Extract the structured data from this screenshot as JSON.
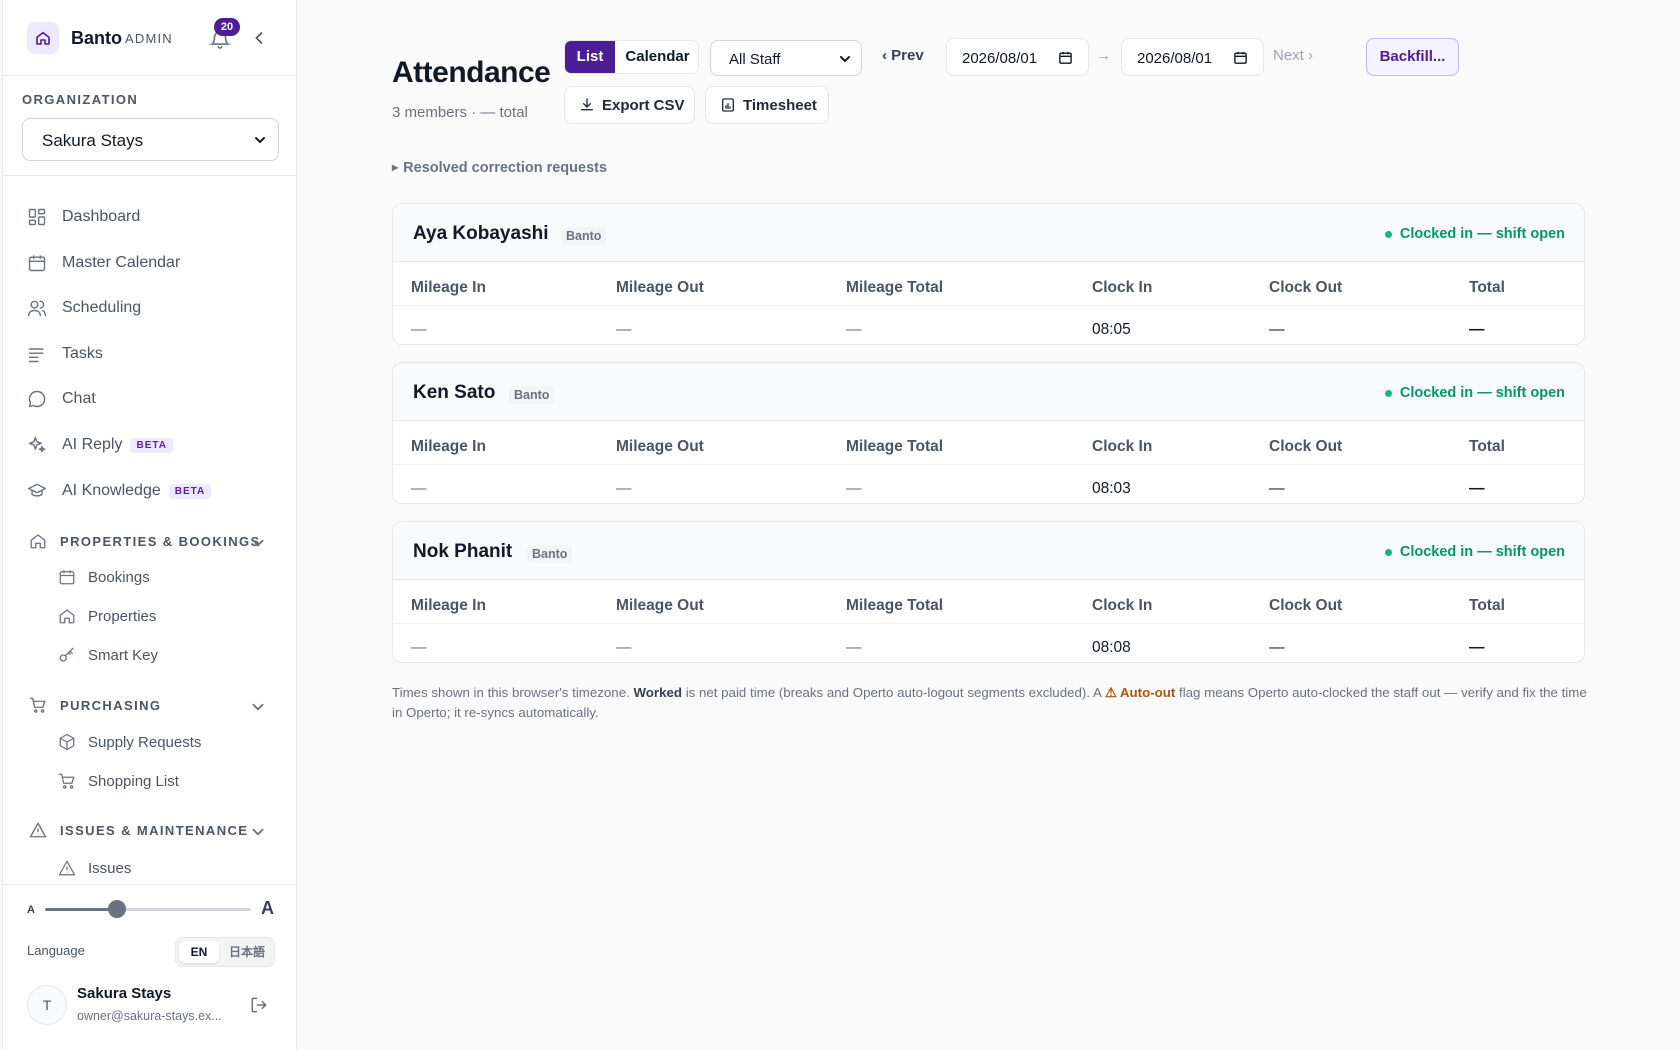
{
  "brand": {
    "name": "Banto",
    "role": "ADMIN",
    "notifications": "20",
    "accent": "#4c1d95"
  },
  "org": {
    "label": "ORGANIZATION",
    "selected": "Sakura Stays"
  },
  "nav": {
    "items": [
      {
        "label": "Dashboard",
        "icon": "dashboard-icon"
      },
      {
        "label": "Master Calendar",
        "icon": "calendar-icon"
      },
      {
        "label": "Scheduling",
        "icon": "users-icon"
      },
      {
        "label": "Tasks",
        "icon": "list-icon"
      },
      {
        "label": "Chat",
        "icon": "chat-icon"
      },
      {
        "label": "AI Reply",
        "icon": "sparkle-icon",
        "badge": "BETA"
      },
      {
        "label": "AI Knowledge",
        "icon": "graduation-cap-icon",
        "badge": "BETA"
      }
    ],
    "sections": [
      {
        "label": "PROPERTIES & BOOKINGS",
        "icon": "home-icon",
        "items": [
          {
            "label": "Bookings",
            "icon": "calendar-icon"
          },
          {
            "label": "Properties",
            "icon": "home-icon"
          },
          {
            "label": "Smart Key",
            "icon": "key-icon"
          }
        ]
      },
      {
        "label": "PURCHASING",
        "icon": "cart-icon",
        "items": [
          {
            "label": "Supply Requests",
            "icon": "box-icon"
          },
          {
            "label": "Shopping List",
            "icon": "cart-icon"
          }
        ]
      },
      {
        "label": "ISSUES & MAINTENANCE",
        "icon": "warning-icon",
        "items": [
          {
            "label": "Issues",
            "icon": "warning-icon"
          }
        ]
      }
    ]
  },
  "footer": {
    "font_small": "A",
    "font_large": "A",
    "font_scale": 0.35,
    "language_label": "Language",
    "lang_en": "EN",
    "lang_ja": "日本語",
    "avatar_initial": "T",
    "user_name": "Sakura Stays",
    "user_email": "owner@sakura-stays.ex..."
  },
  "page": {
    "title": "Attendance",
    "subtitle": "3 members · — total",
    "view_list": "List",
    "view_calendar": "Calendar",
    "staff_filter": "All Staff",
    "prev": "‹ Prev",
    "next": "Next ›",
    "date_from": "2026/08/01",
    "date_to": "2026/08/01",
    "arrow": "→",
    "backfill": "Backfill...",
    "export_csv": "Export CSV",
    "timesheet": "Timesheet",
    "resolved": "Resolved correction requests"
  },
  "columns": [
    "Mileage In",
    "Mileage Out",
    "Mileage Total",
    "Clock In",
    "Clock Out",
    "Total"
  ],
  "members": [
    {
      "name": "Aya Kobayashi",
      "tag": "Banto",
      "status": "Clocked in — shift open",
      "mileage_in": "—",
      "mileage_out": "—",
      "mileage_total": "—",
      "clock_in": "08:05",
      "clock_out": "—",
      "total": "—"
    },
    {
      "name": "Ken Sato",
      "tag": "Banto",
      "status": "Clocked in — shift open",
      "mileage_in": "—",
      "mileage_out": "—",
      "mileage_total": "—",
      "clock_in": "08:03",
      "clock_out": "—",
      "total": "—"
    },
    {
      "name": "Nok Phanit",
      "tag": "Banto",
      "status": "Clocked in — shift open",
      "mileage_in": "—",
      "mileage_out": "—",
      "mileage_total": "—",
      "clock_in": "08:08",
      "clock_out": "—",
      "total": "—"
    }
  ],
  "note": {
    "p1": "Times shown in this browser's timezone. ",
    "worked": "Worked",
    "p2": " is net paid time (breaks and Operto auto-logout segments excluded). A ",
    "autoout": "⚠ Auto-out",
    "p3": " flag means Operto auto-clocked the staff out — verify and fix the time in Operto; it re-syncs automatically."
  }
}
